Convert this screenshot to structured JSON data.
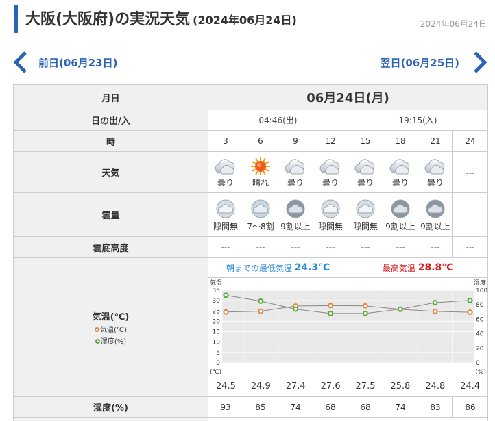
{
  "header": {
    "title": "大阪(大阪府)の実況天気",
    "subtitle": "(2024年06月24日)",
    "date": "2024年06月24日"
  },
  "nav": {
    "prev_label": "前日(06月23日)",
    "next_label": "翌日(06月25日)"
  },
  "table": {
    "row_labels": {
      "date": "月日",
      "sun": "日の出/入",
      "hour": "時",
      "weather": "天気",
      "cloud": "雲量",
      "cloud_base": "雲底高度",
      "temp": "気温(℃)",
      "humidity": "湿度(%)"
    },
    "date": "06月24日(月)",
    "sunrise": "04:46(出)",
    "sunset": "19:15(入)",
    "hours": [
      "3",
      "6",
      "9",
      "12",
      "15",
      "18",
      "21",
      "24"
    ],
    "weather": [
      {
        "label": "曇り",
        "icon": "cloudy-icon"
      },
      {
        "label": "晴れ",
        "icon": "sunny-icon"
      },
      {
        "label": "曇り",
        "icon": "cloudy-icon"
      },
      {
        "label": "曇り",
        "icon": "cloudy-icon"
      },
      {
        "label": "曇り",
        "icon": "cloudy-icon"
      },
      {
        "label": "曇り",
        "icon": "cloudy-icon"
      },
      {
        "label": "曇り",
        "icon": "cloudy-icon"
      },
      {
        "label": "---",
        "icon": ""
      }
    ],
    "cloud": [
      {
        "label": "隙間無",
        "icon": "cloud-cover-icon"
      },
      {
        "label": "7～8割",
        "icon": "cloud-cover-icon"
      },
      {
        "label": "9割以上",
        "icon": "cloud-cover-icon"
      },
      {
        "label": "隙間無",
        "icon": "cloud-cover-icon"
      },
      {
        "label": "隙間無",
        "icon": "cloud-cover-icon"
      },
      {
        "label": "9割以上",
        "icon": "cloud-cover-icon"
      },
      {
        "label": "9割以上",
        "icon": "cloud-cover-icon"
      },
      {
        "label": "---",
        "icon": ""
      }
    ],
    "cloud_base": [
      "---",
      "---",
      "---",
      "---",
      "---",
      "---",
      "---",
      "---"
    ],
    "legend_temp": "気温(℃)",
    "legend_hum": "湿度(%)",
    "min_temp_label": "朝までの最低気温",
    "min_temp_value": "24.3℃",
    "max_temp_label": "最高気温",
    "max_temp_value": "28.8℃",
    "temps": [
      "24.5",
      "24.9",
      "27.4",
      "27.6",
      "27.5",
      "25.8",
      "24.8",
      "24.4"
    ],
    "humidity": [
      "93",
      "85",
      "74",
      "68",
      "68",
      "74",
      "83",
      "86"
    ]
  },
  "chart_data": {
    "type": "line",
    "x": [
      3,
      6,
      9,
      12,
      15,
      18,
      21,
      24
    ],
    "series": [
      {
        "name": "気温(℃)",
        "axis": "left",
        "color": "#e8853b",
        "values": [
          24.5,
          24.9,
          27.4,
          27.6,
          27.5,
          25.8,
          24.8,
          24.4
        ]
      },
      {
        "name": "湿度(%)",
        "axis": "right",
        "color": "#5aaa37",
        "values": [
          93,
          85,
          74,
          68,
          68,
          74,
          83,
          86
        ]
      }
    ],
    "left_axis": {
      "label": "気温",
      "unit": "(℃)",
      "ylim": [
        0,
        35
      ],
      "ticks": [
        "35",
        "30",
        "25",
        "20",
        "15",
        "10",
        "5",
        "0"
      ]
    },
    "right_axis": {
      "label": "湿度",
      "unit": "(%)",
      "ylim": [
        0,
        100
      ],
      "ticks": [
        "100",
        "80",
        "60",
        "40",
        "20",
        "0"
      ]
    },
    "grid": true
  }
}
